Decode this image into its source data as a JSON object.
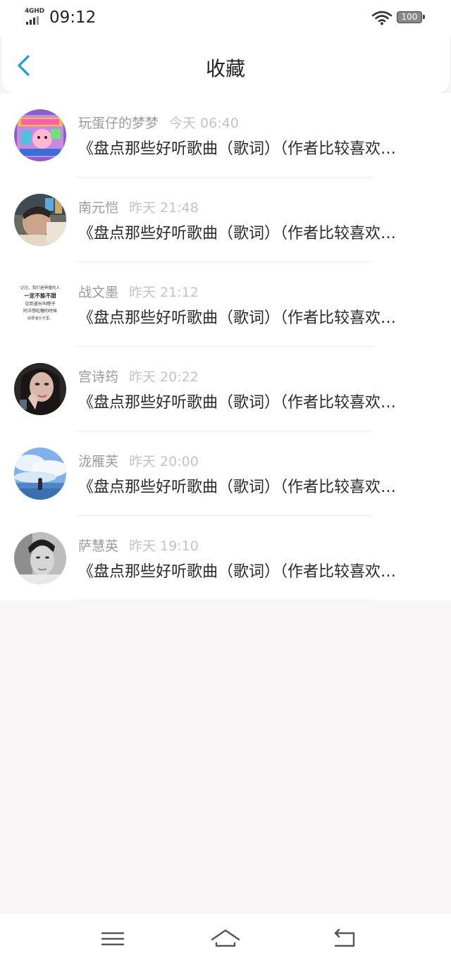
{
  "status_bar": {
    "network": "4GHD",
    "time": "09:12",
    "battery": "100"
  },
  "header": {
    "title": "收藏",
    "back_icon": "chevron-left-icon"
  },
  "colors": {
    "accent": "#1e9be0",
    "background": "#f7f5f6",
    "username": "#9b9b9b",
    "timestamp": "#c3c3c3"
  },
  "favorites": [
    {
      "user": "玩蛋仔的梦梦",
      "time": "今天 06:40",
      "title": "《盘点那些好听歌曲（歌词）（作者比较喜欢…"
    },
    {
      "user": "南元恺",
      "time": "昨天 21:48",
      "title": "《盘点那些好听歌曲（歌词）（作者比较喜欢…"
    },
    {
      "user": "战文墨",
      "time": "昨天 21:12",
      "title": "《盘点那些好听歌曲（歌词）（作者比较喜欢…"
    },
    {
      "user": "宫诗筠",
      "time": "昨天 20:22",
      "title": "《盘点那些好听歌曲（歌词）（作者比较喜欢…"
    },
    {
      "user": "泷雁芙",
      "time": "昨天 20:00",
      "title": "《盘点那些好听歌曲（歌词）（作者比较喜欢…"
    },
    {
      "user": "萨慧英",
      "time": "昨天 19:10",
      "title": "《盘点那些好听歌曲（歌词）（作者比较喜欢…"
    }
  ],
  "avatar_text": {
    "lines": [
      "记住，我们是莽撞的人",
      "一定不能不甜",
      "见到道长叫瞪子",
      "阿洋想吃糖的时候",
      "就要递长手里。"
    ]
  },
  "bottom_nav": {
    "menu_icon": "menu-icon",
    "home_icon": "home-icon",
    "back_icon": "back-arrow-icon"
  }
}
